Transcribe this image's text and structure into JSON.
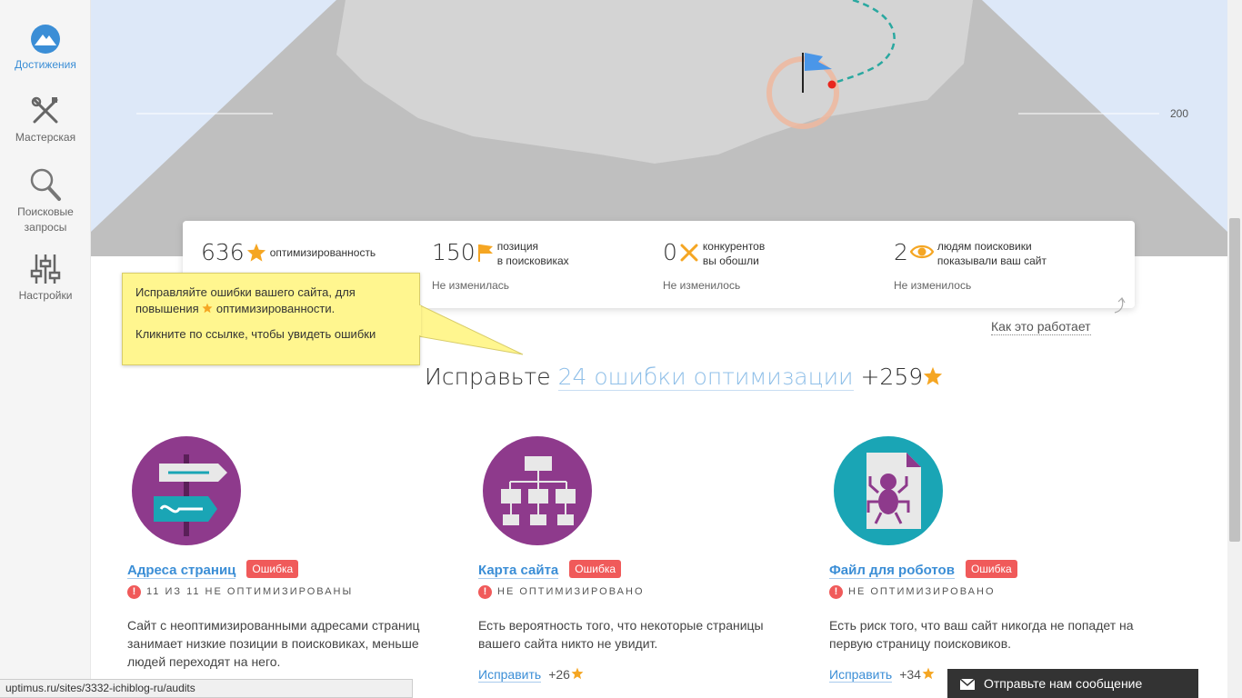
{
  "sidebar": {
    "items": [
      {
        "label": "Достижения"
      },
      {
        "label": "Мастерская"
      },
      {
        "label": "Поисковые запросы"
      },
      {
        "label": "Настройки"
      }
    ]
  },
  "hero": {
    "axis_value": "200"
  },
  "stats": [
    {
      "value": "636",
      "icon": "star-icon",
      "label": "оптимизированность",
      "change": ""
    },
    {
      "value": "150",
      "icon": "flag-icon",
      "label_line1": "позиция",
      "label_line2": "в поисковиках",
      "change": "Не изменилась"
    },
    {
      "value": "0",
      "icon": "cross-icon",
      "label_line1": "конкурентов",
      "label_line2": "вы обошли",
      "change": "Не изменилось"
    },
    {
      "value": "2",
      "icon": "eye-icon",
      "label_line1": "людям поисковики",
      "label_line2": "показывали ваш сайт",
      "change": "Не изменилось"
    }
  ],
  "how_it_works": "Как это работает",
  "tooltip": {
    "line1_a": "Исправляйте ошибки вашего сайта, для",
    "line1_b": "повышения",
    "line1_c": "оптимизированности.",
    "line2": "Кликните по ссылке, чтобы увидеть ошибки"
  },
  "heading": {
    "prefix": "Исправьте",
    "link": "24 ошибки оптимизации",
    "points": "+259"
  },
  "cards": [
    {
      "title": "Адреса страниц",
      "badge": "Ошибка",
      "status": "11 ИЗ 11 НЕ ОПТИМИЗИРОВАНЫ",
      "desc": "Сайт с неоптимизированными адресами страниц занимает низкие позиции в поисковиках, меньше людей переходят на него.",
      "fix": "",
      "points": ""
    },
    {
      "title": "Карта сайта",
      "badge": "Ошибка",
      "status": "НЕ ОПТИМИЗИРОВАНО",
      "desc": "Есть вероятность того, что некоторые страницы вашего сайта никто не увидит.",
      "fix": "Исправить",
      "points": "+26"
    },
    {
      "title": "Файл для роботов",
      "badge": "Ошибка",
      "status": "НЕ ОПТИМИЗИРОВАНО",
      "desc": "Есть риск того, что ваш сайт никогда не попадет на первую страницу поисковиков.",
      "fix": "Исправить",
      "points": "+34"
    }
  ],
  "statusbar": {
    "url": "uptimus.ru/sites/3332-ichiblog-ru/audits"
  },
  "chat": {
    "label": "Отправьте нам сообщение"
  },
  "colors": {
    "accent": "#3b8ed6",
    "error": "#f05a5a",
    "star": "#f5a623",
    "purple": "#8e3a8c",
    "teal": "#1aa5b5",
    "tooltip": "#fff68f"
  }
}
